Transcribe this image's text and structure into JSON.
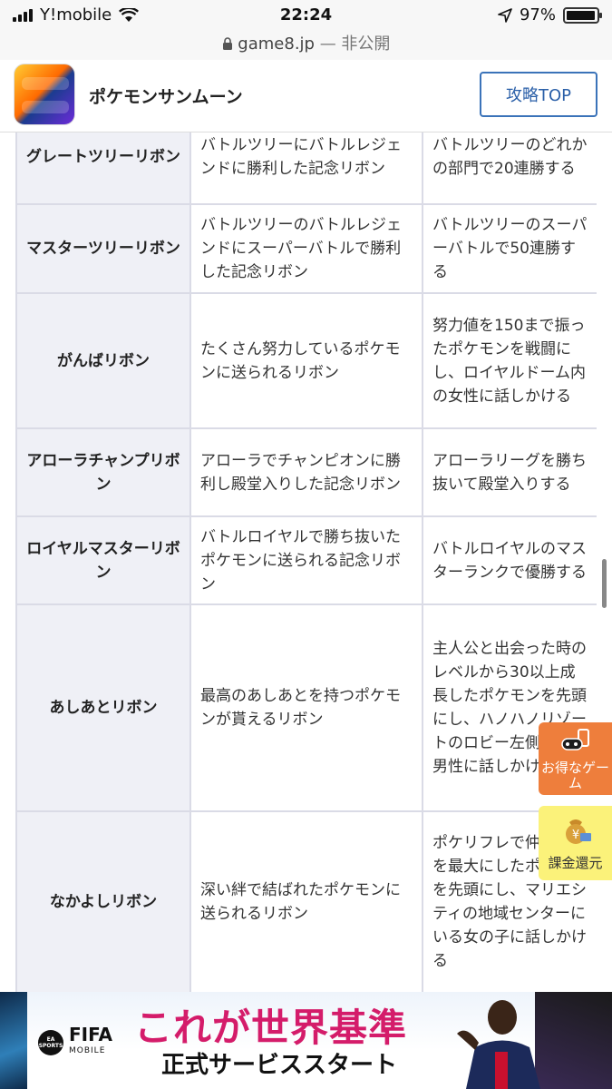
{
  "status_bar": {
    "carrier": "Y!mobile",
    "time": "22:24",
    "battery": "97%",
    "battery_level": 0.97
  },
  "url_bar": {
    "domain": "game8.jp",
    "separator": " — ",
    "visibility": "非公開"
  },
  "site_header": {
    "title": "ポケモンサンムーン",
    "top_button": "攻略TOP"
  },
  "ribbons": [
    {
      "name": "グレートツリーリボン",
      "description": "バトルツリーにバトルレジェンドに勝利した記念リボン",
      "condition": "バトルツリーのどれかの部門で20連勝する"
    },
    {
      "name": "マスターツリーリボン",
      "description": "バトルツリーのバトルレジェンドにスーパーバトルで勝利した記念リボン",
      "condition": "バトルツリーのスーパーバトルで50連勝する"
    },
    {
      "name": "がんばリボン",
      "description": "たくさん努力しているポケモンに送られるリボン",
      "condition": "努力値を150まで振ったポケモンを戦闘にし、ロイヤルドーム内の女性に話しかける"
    },
    {
      "name": "アローラチャンプリボン",
      "description": "アローラでチャンピオンに勝利し殿堂入りした記念リボン",
      "condition": "アローラリーグを勝ち抜いて殿堂入りする"
    },
    {
      "name": "ロイヤルマスターリボン",
      "description": "バトルロイヤルで勝ち抜いたポケモンに送られる記念リボン",
      "condition": "バトルロイヤルのマスターランクで優勝する"
    },
    {
      "name": "あしあとリボン",
      "description": "最高のあしあとを持つポケモンが貰えるリボン",
      "condition": "主人公と出会った時のレベルから30以上成長したポケモンを先頭にし、ハノハノリゾートのロビー左側にいる男性に話しかける"
    },
    {
      "name": "なかよしリボン",
      "description": "深い絆で結ばれたポケモンに送られるリボン",
      "condition": "ポケリフレで仲良し度を最大にしたポケモンを先頭にし、マリエシティの地域センターにいる女の子に話しかける"
    }
  ],
  "floating": {
    "deal_label": "お得なゲーム",
    "refund_label": "課金還元"
  },
  "ad": {
    "brand": "FIFA",
    "brand_sub": "MOBILE",
    "publisher": "EA SPORTS",
    "headline": "これが世界基準",
    "subline": "正式サービススタート"
  }
}
